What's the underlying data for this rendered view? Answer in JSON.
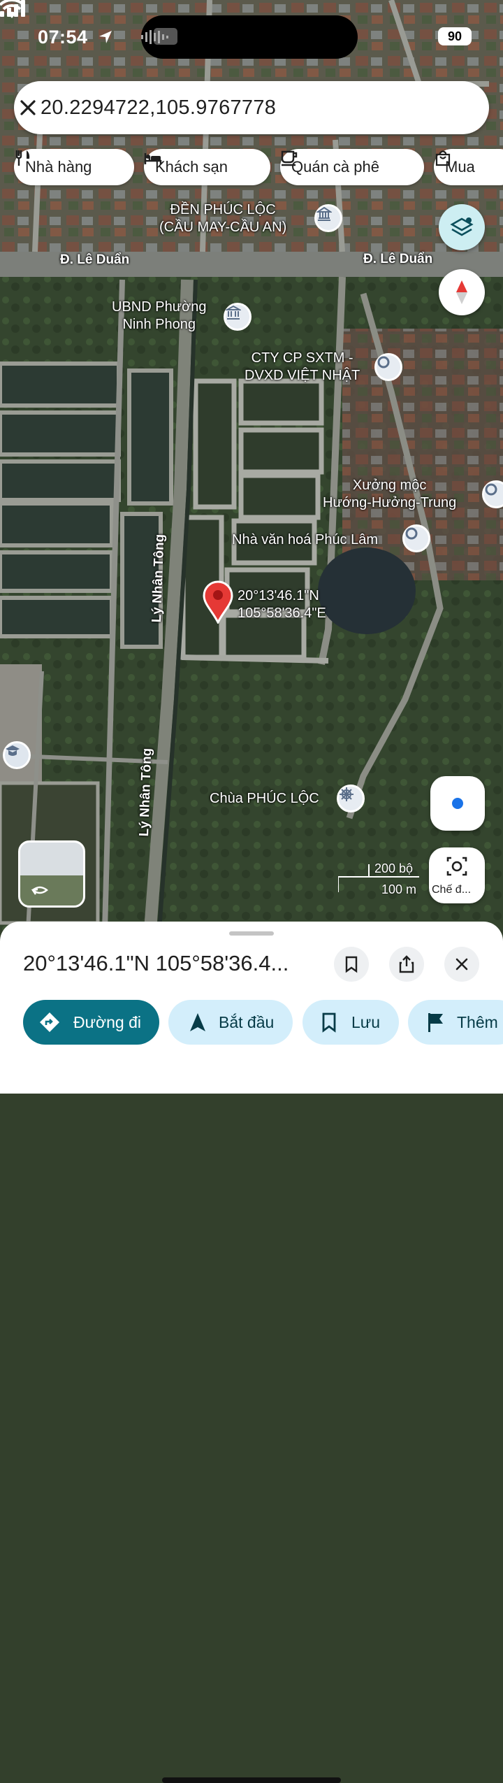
{
  "status_bar": {
    "time": "07:54",
    "battery": "90"
  },
  "search": {
    "query": "20.2294722,105.9767778"
  },
  "chips": [
    {
      "label": "Nhà hàng",
      "icon": "fork-knife-icon"
    },
    {
      "label": "Khách sạn",
      "icon": "bed-icon"
    },
    {
      "label": "Quán cà phê",
      "icon": "coffee-cup-icon"
    },
    {
      "label": "Mua",
      "icon": "shopping-bag-icon"
    }
  ],
  "map": {
    "pois": [
      {
        "line1": "ĐỀN PHÚC LỘC",
        "line2": "(CẦU MAY-CẦU AN)",
        "icon": "temple-icon"
      },
      {
        "line1": "UBND Phường",
        "line2": "Ninh Phong",
        "icon": "government-icon"
      },
      {
        "line1": "CTY CP SXTM -",
        "line2": "DVXD VIỆT NHẬT",
        "icon": "location-pin-icon"
      },
      {
        "line1": "Xưởng mộc",
        "line2": "Hướng-Hưởng-Trung",
        "icon": "location-pin-icon"
      },
      {
        "line1": "Nhà văn hoá Phúc Lâm",
        "icon": "location-pin-icon"
      },
      {
        "line1": "Chùa PHÚC LỘC",
        "icon": "pagoda-wheel-icon"
      }
    ],
    "roads": [
      "Đ. Lê Duẩn",
      "Đ. Lê Duẩn",
      "Lý Nhân Tông",
      "Lý Nhân Tông"
    ],
    "pin": {
      "lat": "20°13'46.1\"N",
      "lng": "105°58'36.4\"E"
    },
    "scale": {
      "imperial": "200 bộ",
      "metric": "100 m"
    },
    "capture_label": "Chế đ..."
  },
  "sheet": {
    "title": "20°13'46.1\"N 105°58'36.4...",
    "actions": [
      {
        "label": "Đường đi",
        "icon": "directions-icon"
      },
      {
        "label": "Bắt đầu",
        "icon": "navigation-arrow-icon"
      },
      {
        "label": "Lưu",
        "icon": "bookmark-icon"
      },
      {
        "label": "Thêm",
        "icon": "flag-icon"
      }
    ]
  },
  "colors": {
    "accent": "#0b7285",
    "chip_light": "#d3eefb",
    "pin": "#e53935"
  }
}
